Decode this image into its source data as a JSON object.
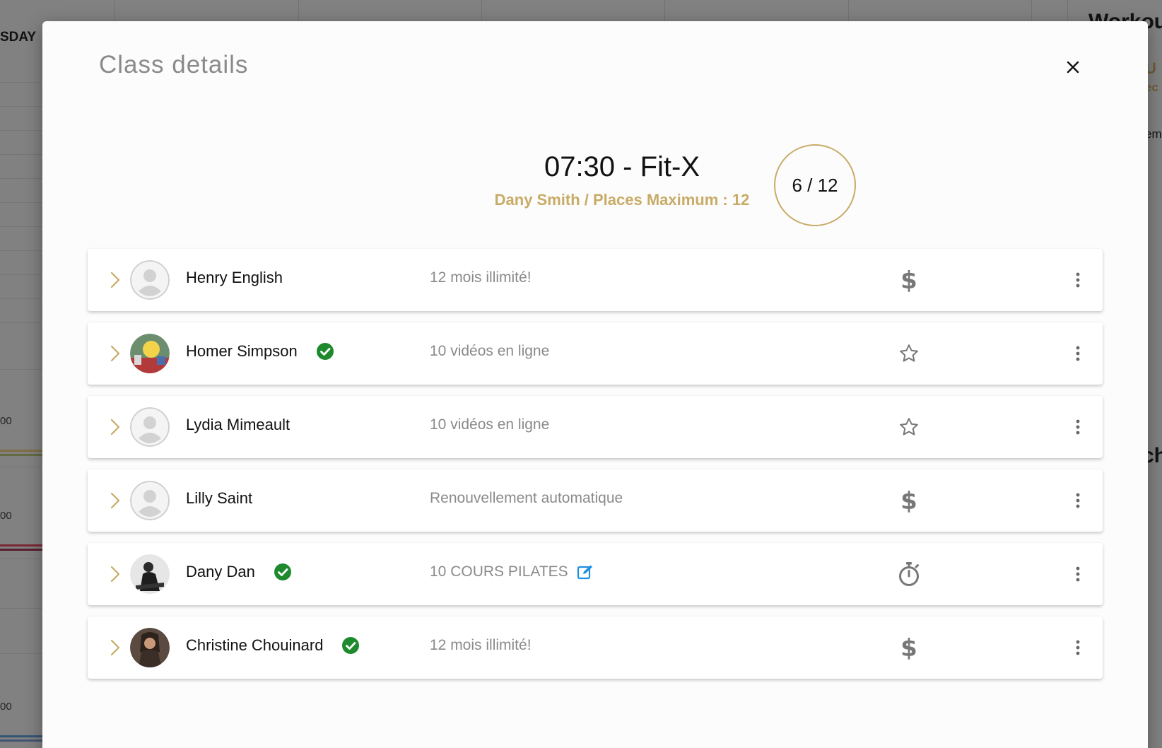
{
  "background": {
    "day_label": "SDAY",
    "hour_labels": [
      "00",
      "00",
      "00"
    ],
    "right_fragments": [
      "Workou",
      "U",
      "ec",
      "em",
      "ch"
    ]
  },
  "modal": {
    "title": "Class details",
    "close_icon": "close-icon"
  },
  "class_info": {
    "title": "07:30 - Fit-X",
    "subtitle": "Dany Smith / Places Maximum : 12",
    "capacity": "6 / 12",
    "accent_color": "#c8ab66"
  },
  "participants": [
    {
      "name": "Henry English",
      "checked_in": false,
      "plan": "12 mois illimité!",
      "plan_edit": false,
      "status_icon": "dollar-icon",
      "avatar": "placeholder"
    },
    {
      "name": "Homer Simpson",
      "checked_in": true,
      "plan": "10 vidéos en ligne",
      "plan_edit": false,
      "status_icon": "star-icon",
      "avatar": "photo"
    },
    {
      "name": "Lydia Mimeault",
      "checked_in": false,
      "plan": "10 vidéos en ligne",
      "plan_edit": false,
      "status_icon": "star-icon",
      "avatar": "placeholder"
    },
    {
      "name": "Lilly Saint",
      "checked_in": false,
      "plan": "Renouvellement automatique",
      "plan_edit": false,
      "status_icon": "dollar-icon",
      "avatar": "placeholder"
    },
    {
      "name": "Dany Dan",
      "checked_in": true,
      "plan": "10 COURS PILATES",
      "plan_edit": true,
      "status_icon": "stopwatch-icon",
      "avatar": "photo"
    },
    {
      "name": "Christine Chouinard",
      "checked_in": true,
      "plan": "12 mois illimité!",
      "plan_edit": false,
      "status_icon": "dollar-icon",
      "avatar": "photo"
    }
  ],
  "colors": {
    "check_green": "#1e8a2e",
    "edit_blue": "#1f8fe0",
    "icon_gray": "#777777"
  }
}
